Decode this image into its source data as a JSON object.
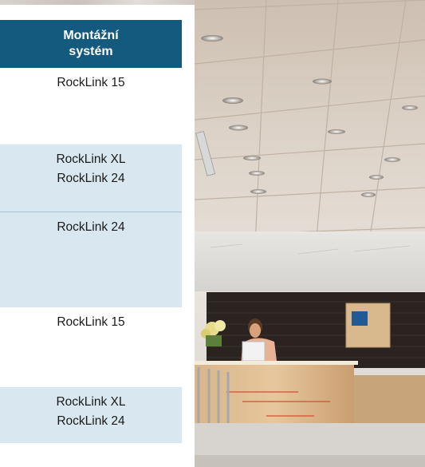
{
  "table": {
    "header": "Montážní systém",
    "rows": [
      {
        "lines": [
          "RockLink 15"
        ]
      },
      {
        "lines": [
          "RockLink XL",
          "RockLink 24"
        ]
      },
      {
        "lines": [
          "RockLink 24"
        ]
      },
      {
        "lines": [
          "RockLink 15"
        ]
      },
      {
        "lines": [
          "RockLink XL",
          "RockLink 24"
        ]
      }
    ]
  },
  "photo": {
    "subject": "office-reception-ceiling"
  },
  "colors": {
    "header_bg": "#135a7e",
    "row_alt_bg": "#d8e7f0",
    "header_text": "#ffffff"
  }
}
